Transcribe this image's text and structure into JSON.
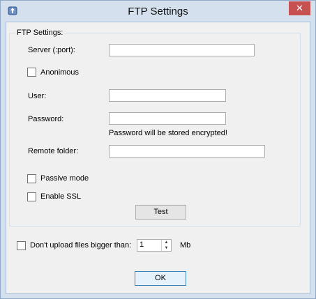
{
  "window": {
    "title": "FTP Settings",
    "close_glyph": "✕",
    "icon": "app-icon"
  },
  "group": {
    "title": "FTP Settings:"
  },
  "server": {
    "label": "Server (:port):",
    "value": ""
  },
  "anonymous": {
    "label": "Anonimous",
    "checked": false
  },
  "user": {
    "label": "User:",
    "value": ""
  },
  "password": {
    "label": "Password:",
    "value": "",
    "note": "Password will be stored encrypted!"
  },
  "remote_folder": {
    "label": "Remote folder:",
    "value": ""
  },
  "passive_mode": {
    "label": "Passive mode",
    "checked": false
  },
  "enable_ssl": {
    "label": "Enable SSL",
    "checked": false
  },
  "test_button": {
    "label": "Test"
  },
  "size_limit": {
    "label": "Don't upload files bigger than:",
    "checked": false,
    "value": "1",
    "unit": "Mb"
  },
  "ok_button": {
    "label": "OK"
  }
}
